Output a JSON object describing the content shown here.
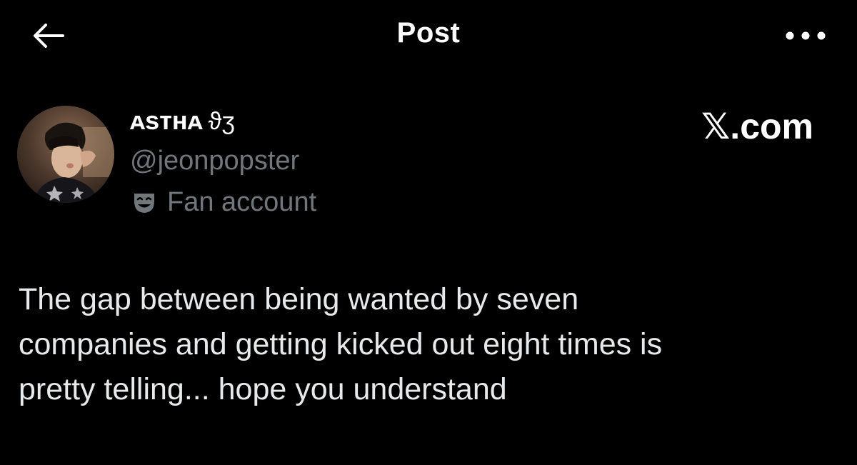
{
  "header": {
    "back_icon": "arrow-left-icon",
    "title": "Post",
    "more_icon": "more-horizontal-icon"
  },
  "author": {
    "display_name": "ᴀsᴛʜᴀ",
    "name_symbol": "ϑʒ",
    "handle": "@jeonpopster",
    "label_icon": "theater-mask-icon",
    "label": "Fan account"
  },
  "watermark": {
    "logo": "𝕏",
    "text": ".com"
  },
  "post": {
    "text": "The gap between being wanted by seven\ncompanies and getting kicked out eight times is\npretty telling... hope you understand"
  },
  "colors": {
    "background": "#000000",
    "primary_text": "#e7e9ea",
    "secondary_text": "#71767b"
  }
}
